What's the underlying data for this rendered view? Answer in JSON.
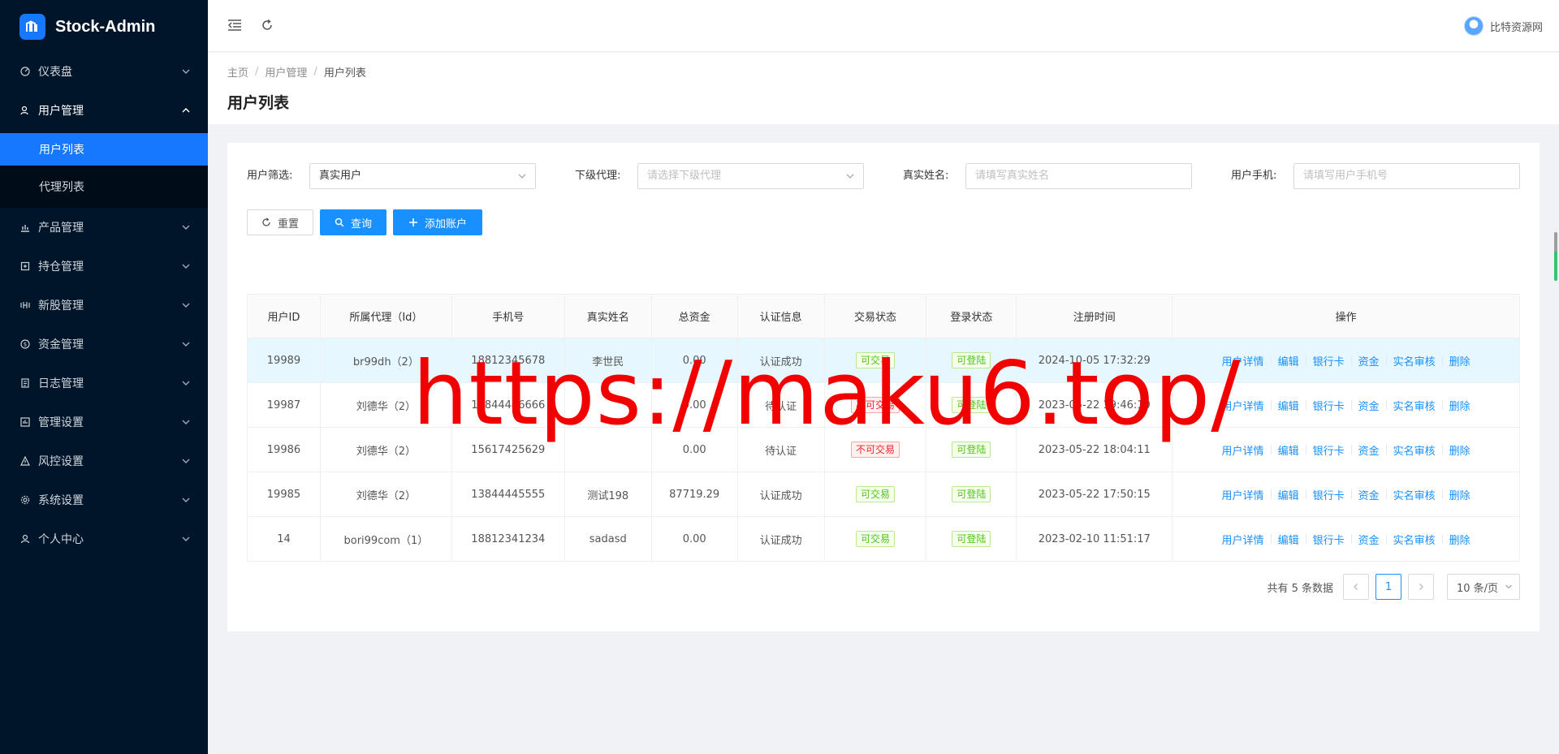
{
  "app": {
    "title": "Stock-Admin"
  },
  "sidebar": {
    "items": [
      {
        "label": "仪表盘",
        "icon": "dashboard-icon"
      },
      {
        "label": "用户管理",
        "icon": "user-manage-icon",
        "open": true,
        "children": [
          {
            "label": "用户列表",
            "active": true
          },
          {
            "label": "代理列表"
          }
        ]
      },
      {
        "label": "产品管理",
        "icon": "chart-icon"
      },
      {
        "label": "持仓管理",
        "icon": "position-icon"
      },
      {
        "label": "新股管理",
        "icon": "ipo-icon"
      },
      {
        "label": "资金管理",
        "icon": "money-icon"
      },
      {
        "label": "日志管理",
        "icon": "log-icon"
      },
      {
        "label": "管理设置",
        "icon": "admin-settings-icon"
      },
      {
        "label": "风控设置",
        "icon": "risk-warning-icon"
      },
      {
        "label": "系统设置",
        "icon": "gear-icon"
      },
      {
        "label": "个人中心",
        "icon": "person-icon"
      }
    ]
  },
  "header": {
    "user_name": "比特资源网"
  },
  "breadcrumb": [
    "主页",
    "用户管理",
    "用户列表"
  ],
  "page": {
    "title": "用户列表"
  },
  "filters": {
    "user_filter_label": "用户筛选:",
    "user_filter_value": "真实用户",
    "agent_label": "下级代理:",
    "agent_placeholder": "请选择下级代理",
    "realname_label": "真实姓名:",
    "realname_placeholder": "请填写真实姓名",
    "phone_label": "用户手机:",
    "phone_placeholder": "请填写用户手机号"
  },
  "buttons": {
    "reset": "重置",
    "query": "查询",
    "add": "添加账户"
  },
  "table": {
    "columns": [
      "用户ID",
      "所属代理（Id）",
      "手机号",
      "真实姓名",
      "总资金",
      "认证信息",
      "交易状态",
      "登录状态",
      "注册时间",
      "操作"
    ],
    "rows": [
      {
        "id": "19989",
        "agent": "br99dh（2）",
        "phone": "18812345678",
        "name": "李世民",
        "funds": "0.00",
        "auth": "认证成功",
        "trade": "可交易",
        "trade_ok": true,
        "login": "可登陆",
        "time": "2024-10-05 17:32:29"
      },
      {
        "id": "19987",
        "agent": "刘德华（2）",
        "phone": "13844446666",
        "name": "",
        "funds": "0.00",
        "auth": "待认证",
        "trade": "不可交易",
        "trade_ok": false,
        "login": "可登陆",
        "time": "2023-05-22 19:46:10"
      },
      {
        "id": "19986",
        "agent": "刘德华（2）",
        "phone": "15617425629",
        "name": "",
        "funds": "0.00",
        "auth": "待认证",
        "trade": "不可交易",
        "trade_ok": false,
        "login": "可登陆",
        "time": "2023-05-22 18:04:11"
      },
      {
        "id": "19985",
        "agent": "刘德华（2）",
        "phone": "13844445555",
        "name": "测试198",
        "funds": "87719.29",
        "auth": "认证成功",
        "trade": "可交易",
        "trade_ok": true,
        "login": "可登陆",
        "time": "2023-05-22 17:50:15"
      },
      {
        "id": "14",
        "agent": "bori99com（1）",
        "phone": "18812341234",
        "name": "sadasd",
        "funds": "0.00",
        "auth": "认证成功",
        "trade": "可交易",
        "trade_ok": true,
        "login": "可登陆",
        "time": "2023-02-10 11:51:17"
      }
    ],
    "actions": [
      "用户详情",
      "编辑",
      "银行卡",
      "资金",
      "实名审核",
      "删除"
    ]
  },
  "pagination": {
    "total_text": "共有 5 条数据",
    "current_page": "1",
    "page_size": "10 条/页"
  },
  "watermark": "https://maku6.top/",
  "colors": {
    "sidebar_bg": "#001529",
    "primary": "#1890ff",
    "success": "#52c41a",
    "danger": "#f5222d",
    "watermark": "#f20000"
  }
}
